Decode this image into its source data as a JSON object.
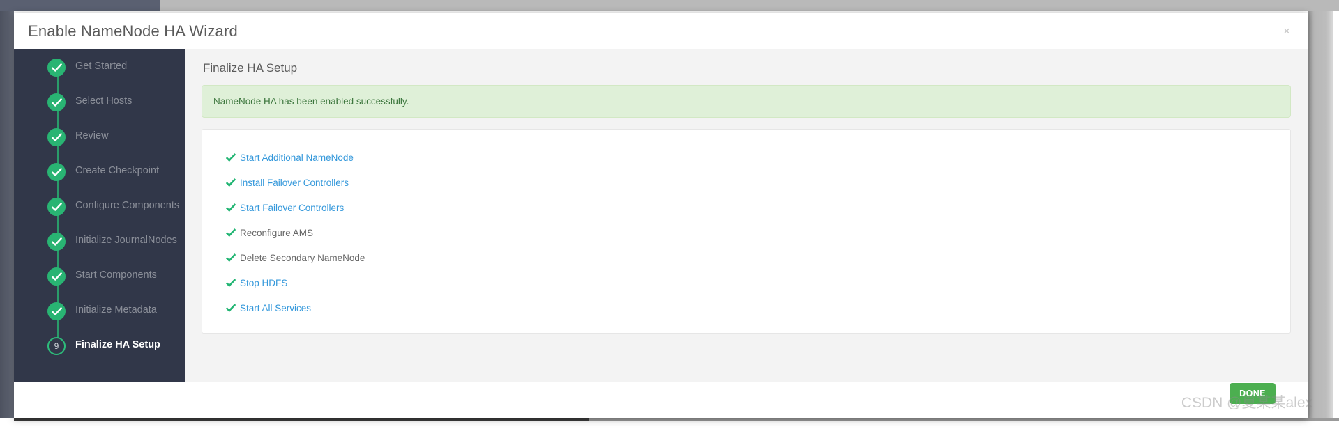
{
  "window": {
    "title": "Enable NameNode HA Wizard",
    "close_icon": "close-icon",
    "close_label": "×"
  },
  "sidebar": {
    "steps": [
      {
        "number": "1",
        "label": "Get Started",
        "state": "done"
      },
      {
        "number": "2",
        "label": "Select Hosts",
        "state": "done"
      },
      {
        "number": "3",
        "label": "Review",
        "state": "done"
      },
      {
        "number": "4",
        "label": "Create Checkpoint",
        "state": "done"
      },
      {
        "number": "5",
        "label": "Configure Components",
        "state": "done"
      },
      {
        "number": "6",
        "label": "Initialize JournalNodes",
        "state": "done"
      },
      {
        "number": "7",
        "label": "Start Components",
        "state": "done"
      },
      {
        "number": "8",
        "label": "Initialize Metadata",
        "state": "done"
      },
      {
        "number": "9",
        "label": "Finalize HA Setup",
        "state": "current"
      }
    ]
  },
  "content": {
    "title": "Finalize HA Setup",
    "alert": {
      "message": "NameNode HA has been enabled successfully.",
      "type": "success",
      "bg_color": "#dff0d8",
      "text_color": "#3c763d"
    },
    "tasks": [
      {
        "label": "Start Additional NameNode",
        "status": "done",
        "is_link": true
      },
      {
        "label": "Install Failover Controllers",
        "status": "done",
        "is_link": true
      },
      {
        "label": "Start Failover Controllers",
        "status": "done",
        "is_link": true
      },
      {
        "label": "Reconfigure AMS",
        "status": "done",
        "is_link": false
      },
      {
        "label": "Delete Secondary NameNode",
        "status": "done",
        "is_link": false
      },
      {
        "label": "Stop HDFS",
        "status": "done",
        "is_link": true
      },
      {
        "label": "Start All Services",
        "status": "done",
        "is_link": true
      }
    ],
    "check_icon": "check-icon",
    "check_color": "#22b573",
    "link_color": "#3498db"
  },
  "footer": {
    "done_label": "DONE",
    "done_color": "#4caf50"
  },
  "watermark": {
    "text": "CSDN @夏某某alex"
  }
}
